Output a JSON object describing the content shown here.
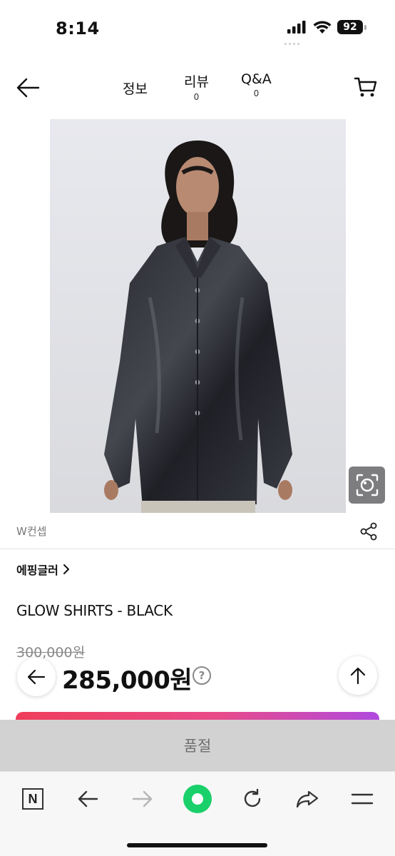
{
  "status_bar": {
    "time": "8:14",
    "battery": "92"
  },
  "nav": {
    "tabs": [
      {
        "label": "정보"
      },
      {
        "label": "리뷰",
        "count": "0"
      },
      {
        "label": "Q&A",
        "count": "0"
      }
    ]
  },
  "product": {
    "seller_sub": "W컨셉",
    "brand": "에핑글러",
    "name": "GLOW SHIRTS - BLACK",
    "original_price": "300,000원",
    "sale_price": "285,000원",
    "help_glyph": "?"
  },
  "purchase": {
    "soldout_label": "품절",
    "accent_gradient": [
      "#ef3e5b",
      "#e94a88",
      "#b04adf"
    ]
  },
  "browser_toolbar": {
    "n_label": "N",
    "accent_color": "#19d06a"
  },
  "icons": [
    "back-arrow-icon",
    "cart-icon",
    "lens-search-icon",
    "share-icon",
    "chevron-right-icon",
    "question-icon",
    "arrow-up-icon",
    "forward-arrow-icon",
    "refresh-icon",
    "share-arrow-icon",
    "menu-icon"
  ]
}
